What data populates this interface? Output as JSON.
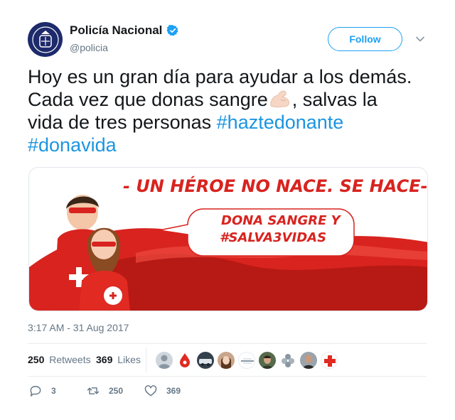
{
  "header": {
    "display_name": "Policía Nacional",
    "handle": "@policia",
    "follow_label": "Follow",
    "verified_icon": "verified-badge-icon",
    "brand_color": "#1da1f2"
  },
  "tweet": {
    "line1": "Hoy es un gran día para ayudar a los demás.",
    "line2a": "Cada vez que donas sangre",
    "line2b": ", salvas la",
    "line3a": "vida de tres personas ",
    "hashtag1": "#haztedonante",
    "hashtag2": "#donavida",
    "emoji": "flexed-biceps-icon"
  },
  "media": {
    "headline": "- UN HÉROE NO NACE. SE HACE-",
    "bubble_line1": "DONA SANGRE Y",
    "bubble_line2": "#SALVA3VIDAS"
  },
  "timestamp": "3:17 AM - 31 Aug 2017",
  "stats": {
    "retweets_count": "250",
    "retweets_label": "Retweets",
    "likes_count": "369",
    "likes_label": "Likes"
  },
  "actions": {
    "replies": "3",
    "retweets": "250",
    "likes": "369"
  }
}
